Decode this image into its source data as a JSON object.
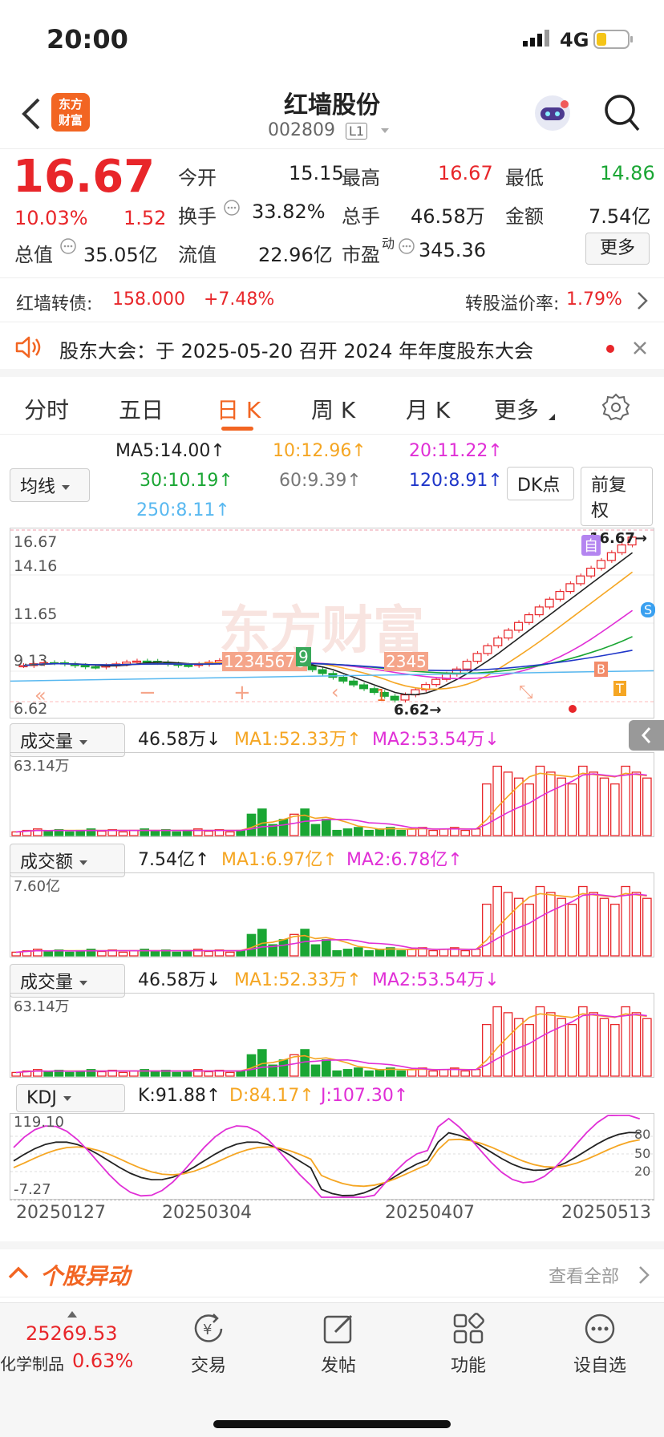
{
  "status": {
    "time": "20:00",
    "network": "4G"
  },
  "header": {
    "title": "红墙股份",
    "code": "002809",
    "level": "L1",
    "logo_text": "东方\n财富"
  },
  "quote": {
    "price": "16.67",
    "pct": "10.03%",
    "change": "1.52",
    "open_label": "今开",
    "open": "15.15",
    "high_label": "最高",
    "high": "16.67",
    "low_label": "最低",
    "low": "14.86",
    "turnover_label": "换手",
    "turnover": "33.82%",
    "volume_label": "总手",
    "volume": "46.58万",
    "amount_label": "金额",
    "amount": "7.54亿",
    "mktcap_label": "总值",
    "mktcap": "35.05亿",
    "float_label": "流值",
    "float": "22.96亿",
    "pe_label": "市盈",
    "pe_sup": "动",
    "pe": "345.36",
    "more": "更多"
  },
  "bond": {
    "label": "红墙转债:",
    "price": "158.000",
    "pct": "+7.48%",
    "premium_label": "转股溢价率:",
    "premium": "1.79%"
  },
  "notice": {
    "text": "股东大会：于 2025-05-20 召开 2024 年年度股东大会"
  },
  "tabs": [
    "分时",
    "五日",
    "日 K",
    "周 K",
    "月 K",
    "更多"
  ],
  "active_tab": 2,
  "ma": {
    "selector": "均线",
    "ma5": "MA5:14.00↑",
    "ma10": "10:12.96↑",
    "ma20": "20:11.22↑",
    "ma30": "30:10.19↑",
    "ma60": "60:9.39↑",
    "ma120": "120:8.91↑",
    "ma250": "250:8.11↑",
    "dk": "DK点",
    "fq": "前复权"
  },
  "kline": {
    "y_labels": [
      "16.67",
      "14.16",
      "11.65",
      "9.13",
      "6.62"
    ],
    "high_mark": "16.67→",
    "low_mark": "6.62→",
    "watermark": "东方财富",
    "seq_labels_1": "12345678",
    "seq_9": "9",
    "seq_labels_2": "2345",
    "seq_1": "1",
    "self_badge": "自"
  },
  "vol1": {
    "selector": "成交量",
    "value": "46.58万↓",
    "ma1": "MA1:52.33万↑",
    "ma2": "MA2:53.54万↓",
    "max": "63.14万"
  },
  "amt": {
    "selector": "成交额",
    "value": "7.54亿↑",
    "ma1": "MA1:6.97亿↑",
    "ma2": "MA2:6.78亿↑",
    "max": "7.60亿"
  },
  "vol2": {
    "selector": "成交量",
    "value": "46.58万↓",
    "ma1": "MA1:52.33万↑",
    "ma2": "MA2:53.54万↓",
    "max": "63.14万"
  },
  "kdj": {
    "selector": "KDJ",
    "k": "K:91.88↑",
    "d": "D:84.17↑",
    "j": "J:107.30↑",
    "top": "119.10",
    "bottom": "-7.27",
    "r80": "80",
    "r50": "50",
    "r20": "20"
  },
  "dates": [
    "20250127",
    "20250304",
    "20250407",
    "20250513"
  ],
  "abnormal": {
    "title": "个股异动",
    "more": "查看全部"
  },
  "bottom": {
    "index_value": "25269.53",
    "index_name": "化学制品",
    "index_pct": "0.63%",
    "trade": "交易",
    "post": "发帖",
    "func": "功能",
    "watch": "设自选"
  },
  "colors": {
    "up": "#e8262a",
    "down": "#1aa634",
    "ma5": "#222222",
    "ma10": "#f5a623",
    "ma20": "#e02fd6",
    "ma30": "#1aa634",
    "ma60": "#888888",
    "ma120": "#1f36c9",
    "ma250": "#58b8f0"
  }
}
